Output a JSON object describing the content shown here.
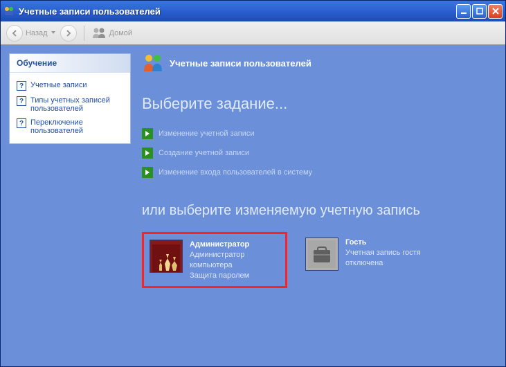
{
  "titlebar": {
    "text": "Учетные записи пользователей"
  },
  "toolbar": {
    "back": "Назад",
    "home": "Домой"
  },
  "sidebar": {
    "panel_title": "Обучение",
    "links": [
      "Учетные записи",
      "Типы учетных записей пользователей",
      "Переключение пользователей"
    ]
  },
  "main": {
    "header": "Учетные записи пользователей",
    "task_heading": "Выберите задание...",
    "tasks": [
      "Изменение учетной записи",
      "Создание учетной записи",
      "Изменение входа пользователей в систему"
    ],
    "sub_heading": "или выберите изменяемую учетную запись",
    "accounts": [
      {
        "name": "Администратор",
        "line1": "Администратор компьютера",
        "line2": "Защита паролем",
        "selected": true,
        "icon": "chess"
      },
      {
        "name": "Гость",
        "line1": "Учетная запись гостя отключена",
        "line2": "",
        "selected": false,
        "icon": "briefcase"
      }
    ]
  }
}
